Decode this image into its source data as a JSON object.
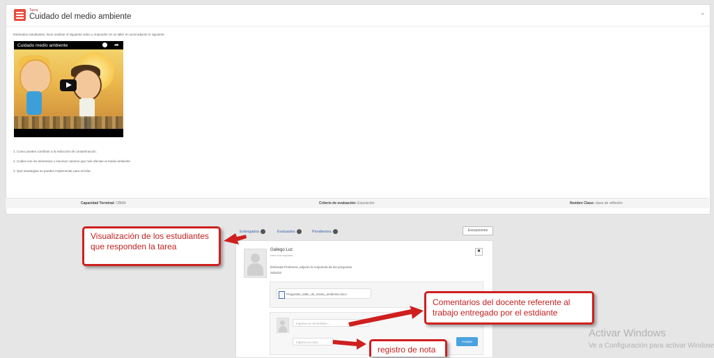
{
  "task": {
    "tag": "Tarea",
    "title": "Cuidado del medio ambiente",
    "intro": "Estimados estudiantes, favor analizar el siguiente video y responder en un taller en word adjunto lo siguiente:",
    "video_title": "Cuidado medio ambiente",
    "questions": [
      "1. Como puedes contribuir a la reducción de contaminación.",
      "2. Cuáles son los elementos o insumos caseros que más afectan al medio ambiente",
      "3. Que estrategias se pueden implementar para reciclar"
    ]
  },
  "meta": {
    "capacidad_label": "Capacidad Terminal:",
    "capacidad_value": "CBMA",
    "criterio_label": "Criterio de evaluación:",
    "criterio_value": "Exposición",
    "clase_label": "Nombre Clase:",
    "clase_value": "clase de reflexión"
  },
  "tabs": [
    {
      "label": "Entregados",
      "count": "1"
    },
    {
      "label": "Evaluados",
      "count": "0"
    },
    {
      "label": "Pendientes",
      "count": "0"
    }
  ],
  "excepciones_label": "Excepciones",
  "submission": {
    "student": "Gallego Luz",
    "subtitle": "hace unos segundos",
    "message_line1": "Estimada Profesora, adjunto la respuesta de las preguntas.",
    "message_line2": "Saludos",
    "file": "Preguntas_taller_de_medio_ambiente.docx",
    "comment_placeholder": "Ingresa un comentario...",
    "grade_placeholder": "Ingresa su nota...",
    "accept_label": "Aceptar"
  },
  "callouts": {
    "students_line1": "Visualización de los estudiantes",
    "students_line2": "que responden la tarea",
    "comments_line1": "Comentarios del docente referente al",
    "comments_line2": "trabajo entregado por el estdiante",
    "grade": "registro de nota"
  },
  "watermark": {
    "line1": "Activar Windows",
    "line2": "Ve a Configuración para activar Windows."
  },
  "colors": {
    "accent_red": "#cf1f1f",
    "link_blue": "#3a66b0",
    "button_blue": "#4aa3df"
  }
}
